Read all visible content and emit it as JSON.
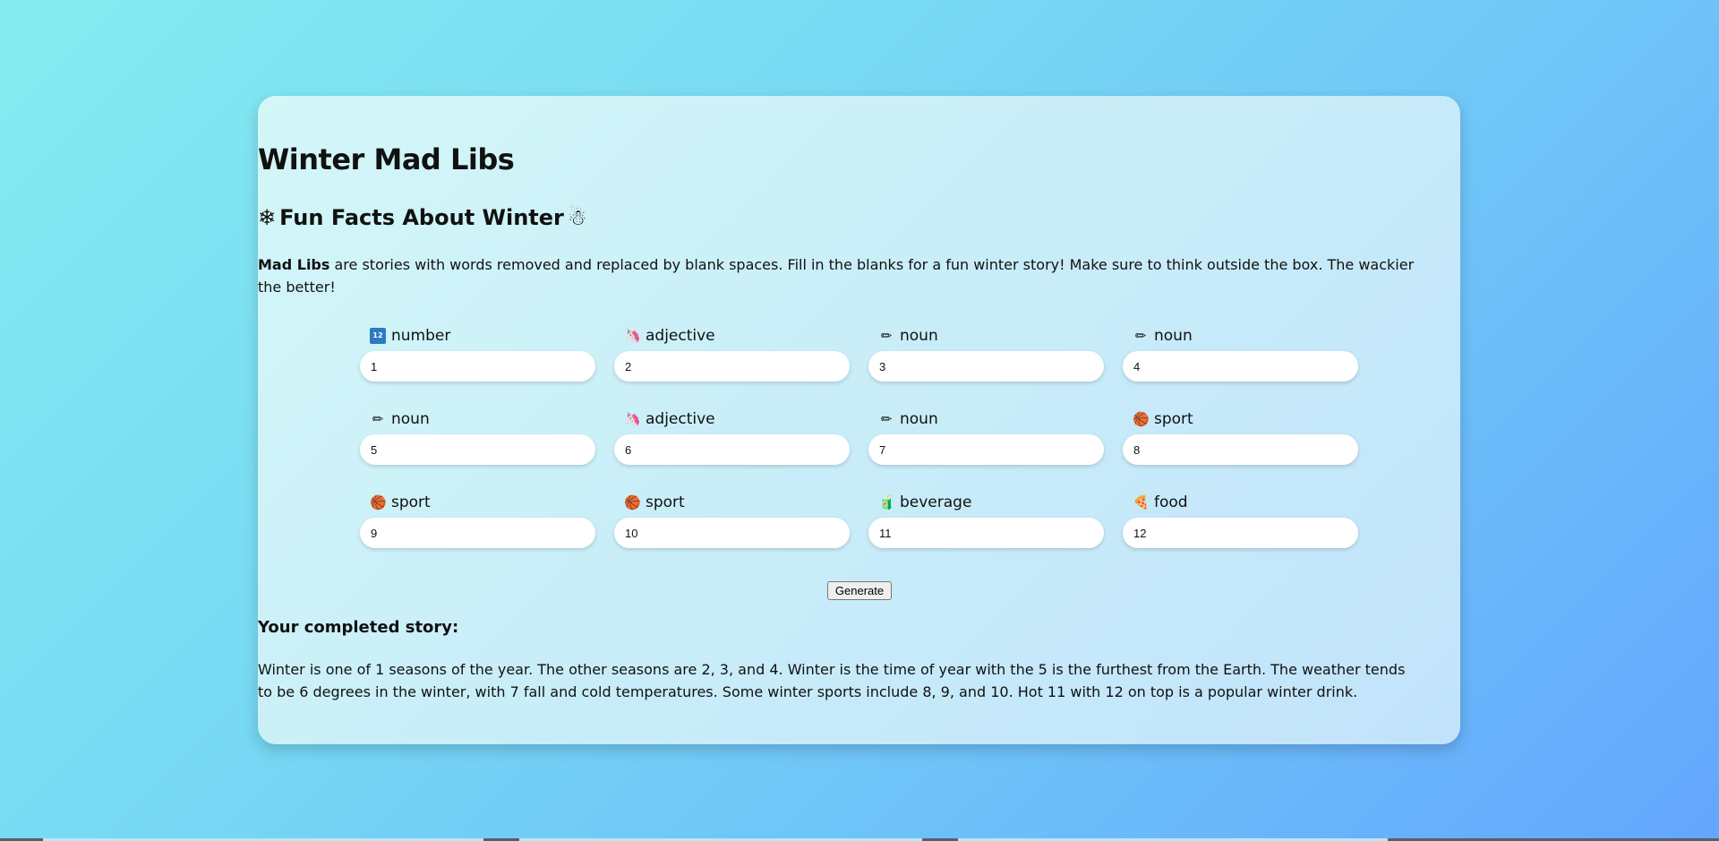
{
  "title": "Winter Mad Libs",
  "subtitle": {
    "icon_left": "snowflake-icon",
    "text": "Fun Facts About Winter",
    "icon_right": "snowman-icon"
  },
  "intro": {
    "bold": "Mad Libs",
    "rest": " are stories with words removed and replaced by blank spaces. Fill in the blanks for a fun winter story! Make sure to think outside the box. The wackier the better!"
  },
  "fields": [
    {
      "label": "number",
      "icon": "number-keycap-icon",
      "value": "1"
    },
    {
      "label": "adjective",
      "icon": "unicorn-icon",
      "value": "2"
    },
    {
      "label": "noun",
      "icon": "pencil-icon",
      "value": "3"
    },
    {
      "label": "noun",
      "icon": "pencil-icon",
      "value": "4"
    },
    {
      "label": "noun",
      "icon": "pencil-icon",
      "value": "5"
    },
    {
      "label": "adjective",
      "icon": "unicorn-icon",
      "value": "6"
    },
    {
      "label": "noun",
      "icon": "pencil-icon",
      "value": "7"
    },
    {
      "label": "sport",
      "icon": "basketball-icon",
      "value": "8"
    },
    {
      "label": "sport",
      "icon": "basketball-icon",
      "value": "9"
    },
    {
      "label": "sport",
      "icon": "basketball-icon",
      "value": "10"
    },
    {
      "label": "beverage",
      "icon": "beverage-box-icon",
      "value": "11"
    },
    {
      "label": "food",
      "icon": "pizza-icon",
      "value": "12"
    }
  ],
  "generate_label": "Generate",
  "story_heading": "Your completed story:",
  "story": "Winter is one of 1 seasons of the year. The other seasons are 2, 3, and 4. Winter is the time of year with the 5 is the furthest from the Earth. The weather tends to be 6 degrees in the winter, with 7 fall and cold temperatures. Some winter sports include 8, 9, and 10. Hot 11 with 12 on top is a popular winter drink.",
  "colors": {
    "background_start": "#84ecf0",
    "background_end": "#64a6fd",
    "card": "#cdf2f9"
  }
}
